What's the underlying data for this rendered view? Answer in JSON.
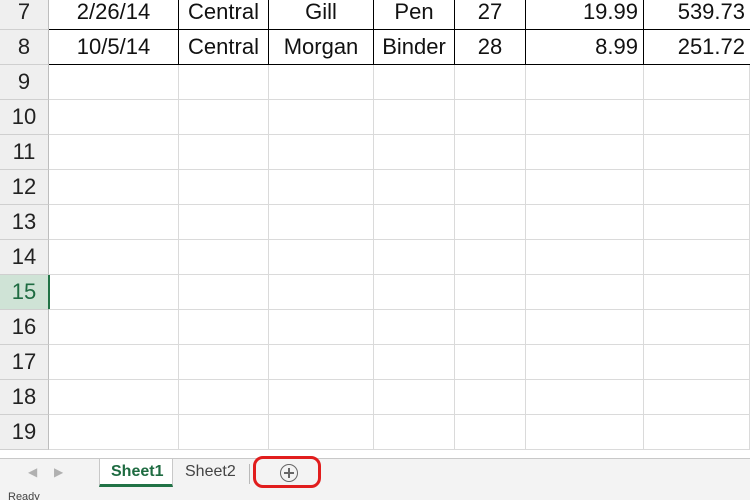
{
  "sheet": {
    "data_rows": [
      {
        "row": "7",
        "cells": [
          "2/26/14",
          "Central",
          "Gill",
          "Pen",
          "27",
          "19.99",
          "539.73"
        ]
      },
      {
        "row": "8",
        "cells": [
          "10/5/14",
          "Central",
          "Morgan",
          "Binder",
          "28",
          "8.99",
          "251.72"
        ]
      }
    ],
    "empty_rows": [
      "9",
      "10",
      "11",
      "12",
      "13",
      "14",
      "15",
      "16",
      "17",
      "18",
      "19"
    ],
    "selected_row": "15"
  },
  "tabs": {
    "nav_prev": "◀",
    "nav_next": "▶",
    "sheets": [
      "Sheet1",
      "Sheet2"
    ],
    "active": "Sheet1",
    "add_sheet_icon": "plus-circle-icon"
  },
  "status": {
    "text": "Ready"
  },
  "colors": {
    "accent": "#217346",
    "highlight": "#e11d1d"
  }
}
